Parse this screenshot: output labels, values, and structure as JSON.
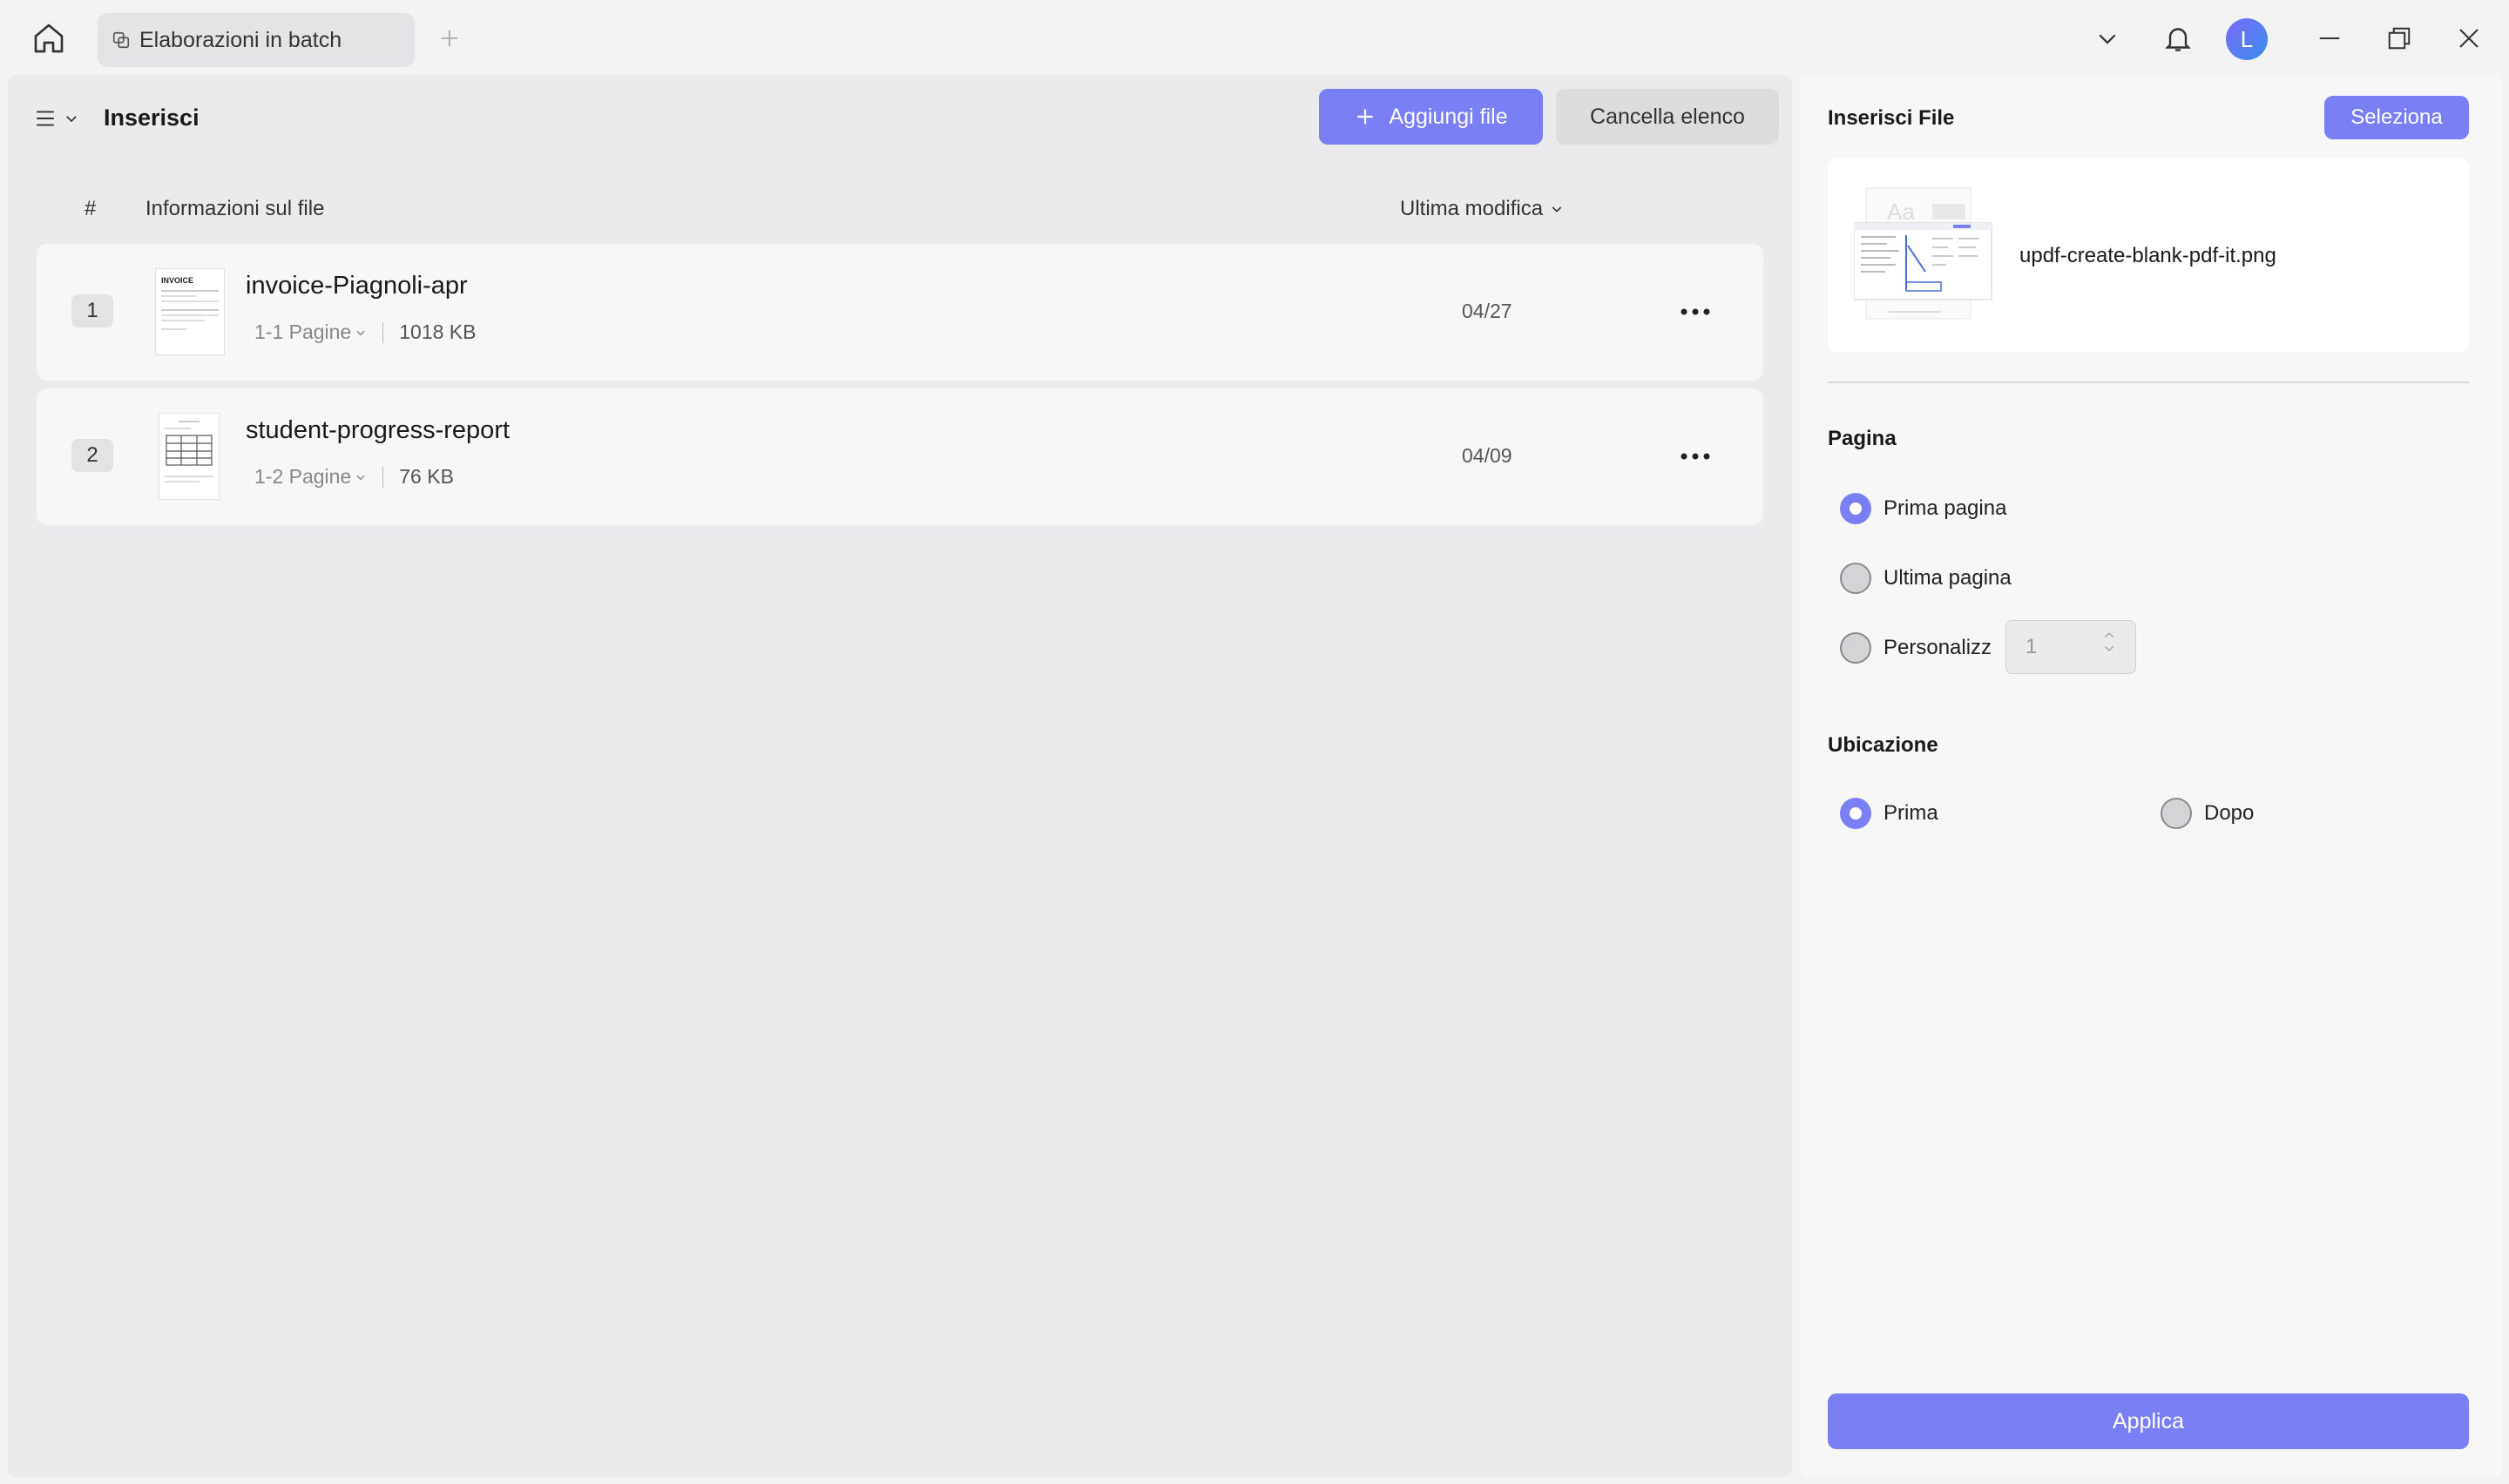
{
  "titlebar": {
    "tab_label": "Elaborazioni in batch",
    "avatar_initial": "L",
    "icons": [
      "home-icon",
      "batch-icon",
      "plus-icon",
      "chevron-down-icon",
      "bell-icon",
      "minimize-icon",
      "restore-icon",
      "close-icon"
    ]
  },
  "left_panel": {
    "title": "Inserisci",
    "add_files_label": "Aggiungi file",
    "clear_list_label": "Cancella elenco",
    "columns": {
      "index": "#",
      "info": "Informazioni sul file",
      "last_modified": "Ultima modifica"
    },
    "files": [
      {
        "index": "1",
        "name": "invoice-Piagnoli-apr",
        "pages": "1-1 Pagine",
        "size": "1018 KB",
        "date": "04/27",
        "thumb_text": "INVOICE"
      },
      {
        "index": "2",
        "name": "student-progress-report",
        "pages": "1-2 Pagine",
        "size": "76 KB",
        "date": "04/09"
      }
    ]
  },
  "right_panel": {
    "title": "Inserisci File",
    "select_label": "Seleziona",
    "selected_file": "updf-create-blank-pdf-it.png",
    "thumb_text": "Aa",
    "page_section": {
      "label": "Pagina",
      "options": [
        "Prima pagina",
        "Ultima pagina",
        "Personalizz"
      ],
      "selected": 0,
      "custom_value": "1"
    },
    "location_section": {
      "label": "Ubicazione",
      "options": [
        "Prima",
        "Dopo"
      ],
      "selected": 0
    },
    "apply_label": "Applica"
  },
  "colors": {
    "accent": "#7b7ff4",
    "panel_bg": "#ebebed",
    "row_bg": "#f7f7f8"
  }
}
